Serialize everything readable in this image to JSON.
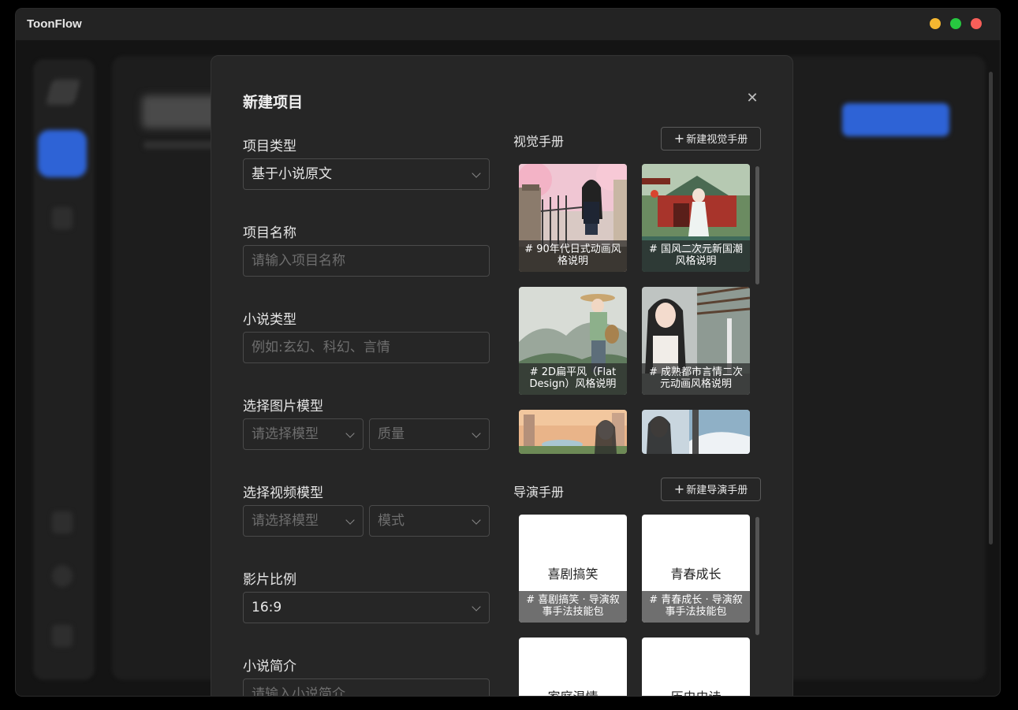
{
  "app": {
    "title": "ToonFlow"
  },
  "modal": {
    "title": "新建项目",
    "fields": {
      "project_type": {
        "label": "项目类型",
        "value": "基于小说原文"
      },
      "project_name": {
        "label": "项目名称",
        "placeholder": "请输入项目名称"
      },
      "novel_type": {
        "label": "小说类型",
        "placeholder": "例如:玄幻、科幻、言情"
      },
      "image_model": {
        "label": "选择图片模型",
        "model_placeholder": "请选择模型",
        "quality_placeholder": "质量"
      },
      "video_model": {
        "label": "选择视频模型",
        "model_placeholder": "请选择模型",
        "mode_placeholder": "模式"
      },
      "aspect_ratio": {
        "label": "影片比例",
        "value": "16:9"
      },
      "novel_summary": {
        "label": "小说简介",
        "placeholder": "请输入小说简介"
      }
    },
    "visual_manual": {
      "title": "视觉手册",
      "new_button": "新建视觉手册",
      "cards": [
        {
          "caption": "# 90年代日式动画风格说明"
        },
        {
          "caption": "# 国风二次元新国潮风格说明"
        },
        {
          "caption": "# 2D扁平风（Flat Design）风格说明"
        },
        {
          "caption": "# 成熟都市言情二次元动画风格说明"
        },
        {
          "caption": ""
        },
        {
          "caption": ""
        }
      ]
    },
    "director_manual": {
      "title": "导演手册",
      "new_button": "新建导演手册",
      "cards": [
        {
          "name": "喜剧搞笑",
          "caption": "# 喜剧搞笑 · 导演叙事手法技能包"
        },
        {
          "name": "青春成长",
          "caption": "# 青春成长 · 导演叙事手法技能包"
        },
        {
          "name": "家庭温情",
          "caption": ""
        },
        {
          "name": "历史史诗",
          "caption": ""
        }
      ]
    }
  }
}
